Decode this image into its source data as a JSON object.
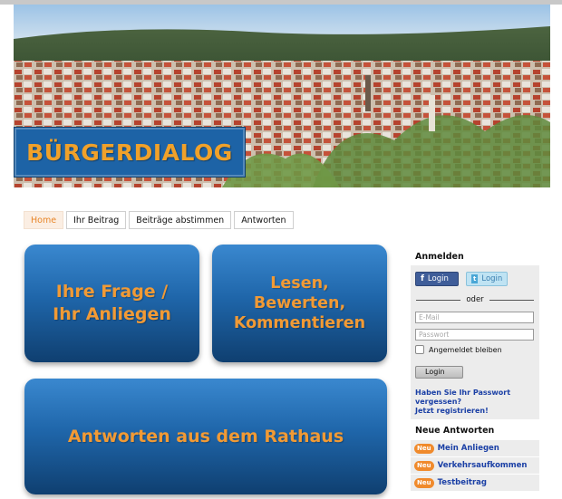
{
  "banner": {
    "title": "BÜRGERDIALOG",
    "image_alt": "city-panorama"
  },
  "nav": {
    "tabs": [
      {
        "label": "Home",
        "active": true
      },
      {
        "label": "Ihr Beitrag",
        "active": false
      },
      {
        "label": "Beiträge abstimmen",
        "active": false
      },
      {
        "label": "Antworten",
        "active": false
      }
    ]
  },
  "tiles": {
    "ask": "Ihre Frage /\nIhr Anliegen",
    "read": "Lesen,\nBewerten,\nKommentieren",
    "answers": "Antworten aus dem Rathaus"
  },
  "sidebar": {
    "login_title": "Anmelden",
    "facebook_label": "Login",
    "facebook_icon": "f",
    "twitter_label": "Login",
    "twitter_icon": "t",
    "or_label": "oder",
    "email_placeholder": "E-Mail",
    "password_placeholder": "Passwort",
    "remember_label": "Angemeldet bleiben",
    "login_button": "Login",
    "forgot_link": "Haben Sie Ihr Passwort vergessen?",
    "register_link": "Jetzt registrieren!",
    "answers_title": "Neue Antworten",
    "answers": [
      {
        "badge": "Neu",
        "label": "Mein Anliegen"
      },
      {
        "badge": "Neu",
        "label": "Verkehrsaufkommen"
      },
      {
        "badge": "Neu",
        "label": "Testbeitrag"
      }
    ]
  },
  "colors": {
    "accent_orange": "#f19a35",
    "tile_blue": "#1f66aa",
    "link_blue": "#1a3fa5",
    "facebook": "#3f5d99",
    "twitter": "#bfe3f3"
  }
}
